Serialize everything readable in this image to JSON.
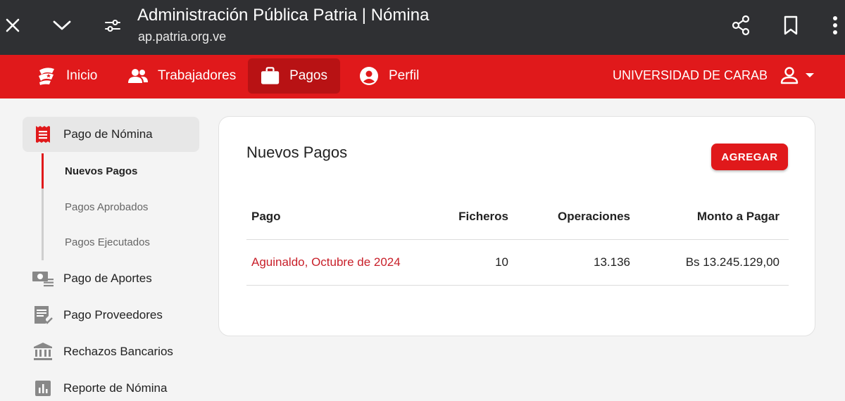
{
  "browser": {
    "title": "Administración Pública Patria | Nómina",
    "url": "ap.patria.org.ve",
    "icons": [
      "close-icon",
      "chevron-down-icon",
      "site-settings-icon",
      "share-icon",
      "bookmark-icon",
      "more-vert-icon"
    ]
  },
  "nav": {
    "items": [
      {
        "label": "Inicio",
        "icon": "patria-logo-icon"
      },
      {
        "label": "Trabajadores",
        "icon": "people-icon"
      },
      {
        "label": "Pagos",
        "icon": "briefcase-icon",
        "active": true
      },
      {
        "label": "Perfil",
        "icon": "account-circle-icon"
      }
    ],
    "org": "UNIVERSIDAD DE CARAB",
    "brand_color": "#e0191b"
  },
  "sidebar": {
    "items": [
      {
        "label": "Pago de Nómina",
        "icon": "receipt-icon",
        "active": true
      },
      {
        "label": "Pago de Aportes",
        "icon": "money-list-icon"
      },
      {
        "label": "Pago Proveedores",
        "icon": "receipt-check-icon"
      },
      {
        "label": "Rechazos Bancarios",
        "icon": "bank-icon"
      },
      {
        "label": "Reporte de Nómina",
        "icon": "bar-chart-icon"
      }
    ],
    "subitems": [
      {
        "label": "Nuevos Pagos",
        "active": true
      },
      {
        "label": "Pagos Aprobados"
      },
      {
        "label": "Pagos Ejecutados"
      }
    ]
  },
  "main": {
    "title": "Nuevos Pagos",
    "add_button": "AGREGAR",
    "table": {
      "headers": [
        "Pago",
        "Ficheros",
        "Operaciones",
        "Monto a Pagar"
      ],
      "rows": [
        [
          "Aguinaldo, Octubre de 2024",
          "10",
          "13.136",
          "Bs 13.245.129,00"
        ]
      ]
    }
  }
}
